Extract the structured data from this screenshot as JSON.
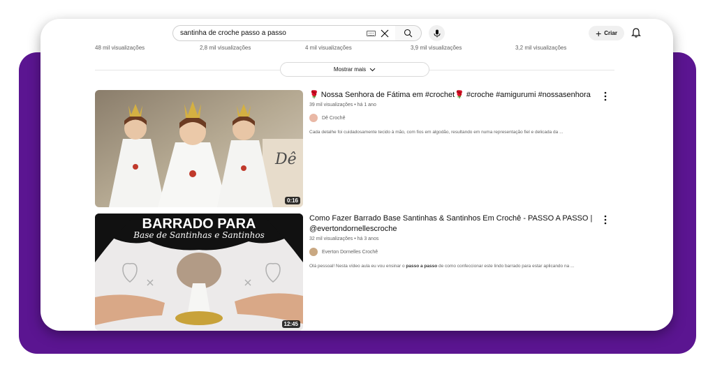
{
  "search": {
    "query": "santinha de croche passo a passo"
  },
  "header": {
    "create_label": "Criar"
  },
  "views_row": [
    "48 mil visualizações",
    "2,8 mil visualizações",
    "4 mil visualizações",
    "3,9 mil visualizações",
    "3,2 mil visualizações"
  ],
  "show_more_label": "Mostrar mais",
  "videos": [
    {
      "title": "🌹 Nossa Senhora de Fátima em #crochet🌹 #croche #amigurumi #nossasenhora",
      "meta": "39 mil visualizações • há 1 ano",
      "channel": "Dê Crochê",
      "description_prefix": "Cada detalhe foi cuidadosamente tecido à mão, com fios em algodão, resultando em numa representação fiel e delicada da ...",
      "description_bold": "",
      "description_suffix": "",
      "duration": "0:16"
    },
    {
      "title": "Como Fazer Barrado Base Santinhas & Santinhos Em Crochê - PASSO A PASSO | @evertondornellescroche",
      "meta": "32 mil visualizações • há 3 anos",
      "channel": "Everton Dornelles Crochê",
      "description_prefix": "Olá pessoal! Nesta vídeo aula eu vou ensinar o ",
      "description_bold": "passo a passo",
      "description_suffix": " de como confeccionar este lindo barrado para estar aplicando na ...",
      "duration": "12:45",
      "thumb_text_1": "BARRADO PARA",
      "thumb_text_2": "Base de Santinhas e Santinhos"
    }
  ],
  "colors": {
    "purple": "#5b1591",
    "text_primary": "#0f0f0f",
    "text_secondary": "#606060"
  }
}
